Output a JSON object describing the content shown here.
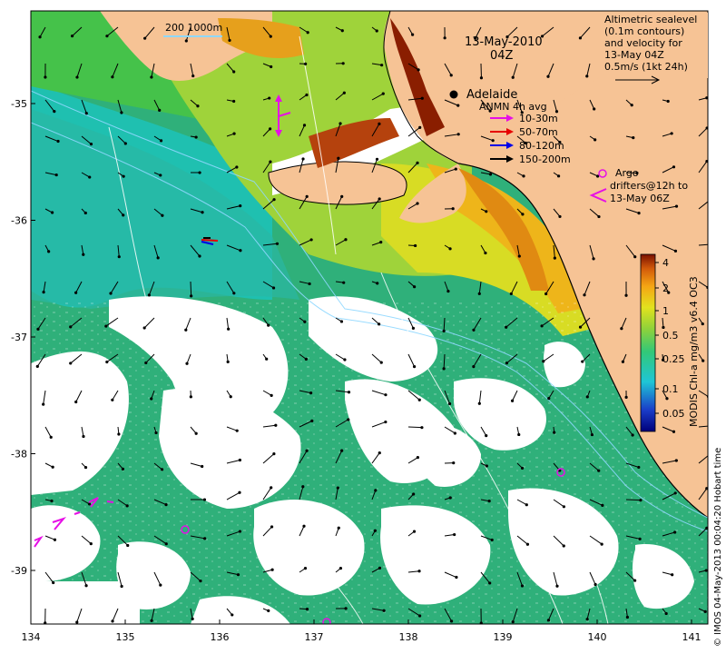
{
  "map": {
    "date_title": "13-May-2010",
    "time_title": "04Z",
    "scale_label": "200  1000m",
    "place_label": "Adelaide",
    "info_lines": [
      "Altimetric sealevel",
      "(0.1m contours)",
      "and velocity for",
      "13-May 04Z",
      "0.5m/s (1kt 24h)"
    ],
    "anmn_title": "ANMN 4h avg",
    "anmn_items": [
      {
        "label": "10-30m",
        "color": "#e60fe6"
      },
      {
        "label": "50-70m",
        "color": "#e60000"
      },
      {
        "label": "80-120m",
        "color": "#0000e6"
      },
      {
        "label": "150-200m",
        "color": "#000000"
      }
    ],
    "argo_label": "Argo",
    "drifter_label_1": "drifters@12h to",
    "drifter_label_2": "13-May 06Z",
    "colorbar_title": "MODIS Chl-a mg/m3 v6.4 OC3",
    "colorbar_ticks": [
      "4",
      "2",
      "1",
      "0.5",
      "0.25",
      "0.1",
      "0.05"
    ],
    "credit": "© IMOS 04-May-2013 00:04:20 Hobart time",
    "x_ticks": [
      "134",
      "135",
      "136",
      "137",
      "138",
      "139",
      "140",
      "141"
    ],
    "y_ticks": [
      "-35",
      "-36",
      "-37",
      "-38",
      "-39"
    ],
    "colors": {
      "land": "#f6c395",
      "no_data": "#ffffff",
      "accent": "#e60fe6"
    }
  }
}
